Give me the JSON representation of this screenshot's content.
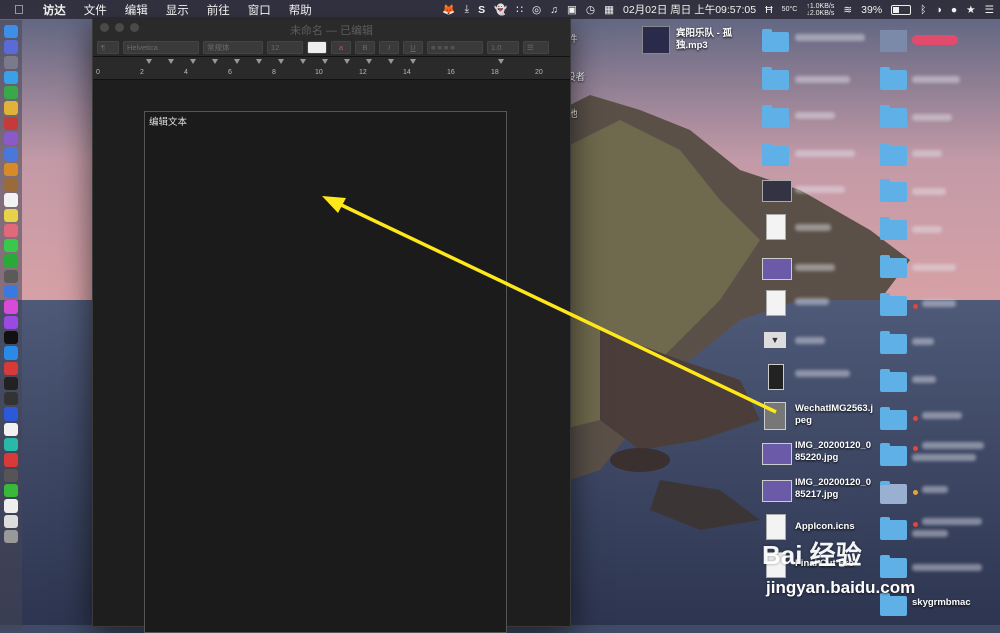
{
  "menubar": {
    "apple_icon": "apple-icon",
    "items": [
      "访达",
      "文件",
      "编辑",
      "显示",
      "前往",
      "窗口",
      "帮助"
    ],
    "status": {
      "net_up": "1.0KB/s",
      "net_down": "2.0KB/s",
      "temp": "50°C",
      "datetime": "02月02日 周日 上午09:57:05",
      "battery": "39%"
    }
  },
  "window": {
    "title": "未命名 — 已编辑",
    "toolbar": {
      "paragraph": "¶",
      "font": "Helvetica",
      "style": "常规体",
      "size": "12",
      "bold": "B",
      "italic": "I",
      "underline": "U",
      "spacing": "1.0"
    },
    "ruler_numbers": [
      "0",
      "2",
      "4",
      "6",
      "8",
      "10",
      "12",
      "14",
      "16",
      "18",
      "20"
    ],
    "document_text": "编辑文本"
  },
  "desktop": {
    "side_text": [
      "件",
      "设者",
      "他"
    ],
    "music_file": "宾阳乐队 - 孤独.mp3",
    "files": [
      "WechatIMG2563.jpeg",
      "IMG_20200120_085220.jpg",
      "IMG_20200120_085217.jpg",
      "AppIcon.icns",
      "Final Cut Pro",
      "skygrmbmac"
    ]
  },
  "watermark": {
    "logo_text": "Bai 经验",
    "url": "jingyan.baidu.com"
  },
  "colors": {
    "folder": "#5fb0e6",
    "arrow": "#ffe81a",
    "window_bg": "#1d1d1d"
  }
}
